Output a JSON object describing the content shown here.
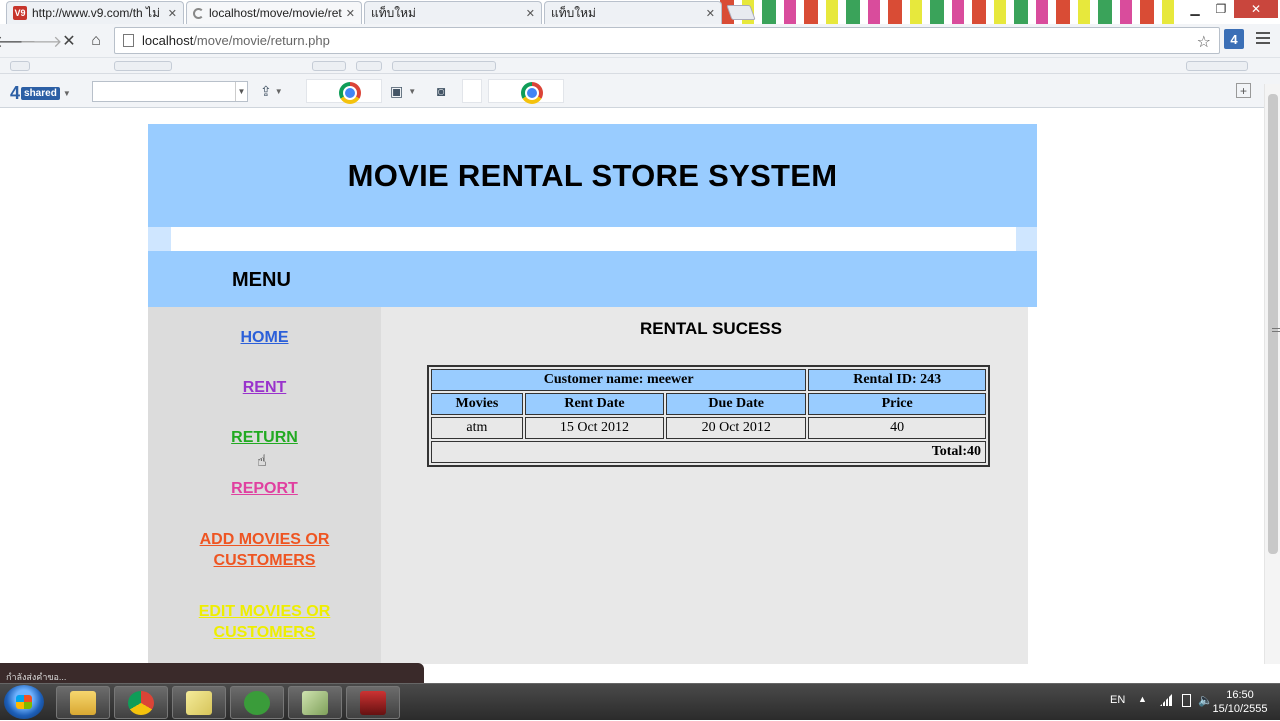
{
  "browser": {
    "tabs": [
      {
        "title": "http://www.v9.com/th ไม่",
        "favicon": "V9",
        "active": false
      },
      {
        "title": "localhost/move/movie/ret",
        "favicon": "loading",
        "active": true
      },
      {
        "title": "แท็บใหม่",
        "favicon": "",
        "active": false
      },
      {
        "title": "แท็บใหม่",
        "favicon": "",
        "active": false
      }
    ],
    "url_host": "localhost",
    "url_path": "/move/movie/return.php",
    "toolbar_logo_number": "4",
    "toolbar_logo_text": "shared",
    "search_value": "",
    "chrome_shortcut_1": "C",
    "chrome_shortcut_2": "C",
    "extension_label": "4",
    "add_button_label": "+"
  },
  "page": {
    "site_title": "MOVIE RENTAL STORE SYSTEM",
    "menu_title": "MENU",
    "nav": {
      "home": "HOME",
      "rent": "RENT",
      "return": "RETURN",
      "report": "REPORT",
      "add": "ADD MOVIES OR CUSTOMERS",
      "edit": "EDIT MOVIES OR CUSTOMERS"
    },
    "result_title": "RENTAL SUCESS",
    "table": {
      "customer": "Customer name: meewer",
      "rental_id": "Rental ID: 243",
      "headers": [
        "Movies",
        "Rent Date",
        "Due Date",
        "Price"
      ],
      "rows": [
        [
          "atm",
          "15 Oct 2012",
          "20 Oct 2012",
          "40"
        ]
      ],
      "total": "Total:40"
    }
  },
  "status_text": "กำลังส่งคำขอ...",
  "taskbar": {
    "apps": [
      "file-explorer",
      "chrome",
      "notes",
      "utorrent",
      "money",
      "media"
    ],
    "lang": "EN",
    "time": "16:50",
    "date": "15/10/2555"
  },
  "colors": {
    "header_bg": "#99ccff",
    "sidebar_bg": "#dcdcdc",
    "content_bg": "#e8e8e8",
    "nav_home": "#2b5fd9",
    "nav_rent": "#9933cc",
    "nav_return": "#22aa22",
    "nav_report": "#e040a0",
    "nav_add": "#ee5522",
    "nav_edit": "#eeee00"
  }
}
